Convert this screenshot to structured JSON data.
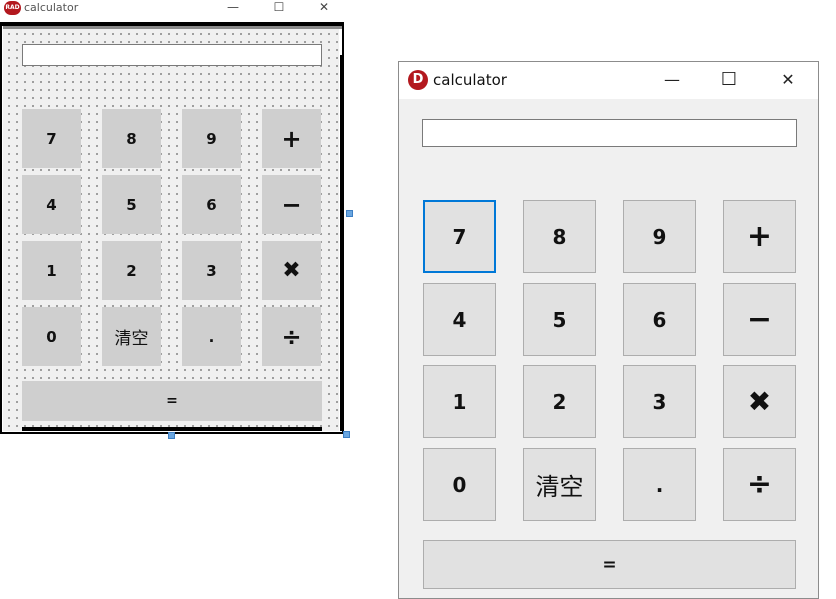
{
  "designer": {
    "logo_text": "RAD",
    "title": "calculator",
    "controls": {
      "minimize": "—",
      "maximize": "☐",
      "close": "✕"
    },
    "display_value": "",
    "buttons": {
      "b7": "7",
      "b8": "8",
      "b9": "9",
      "plus": "+",
      "b4": "4",
      "b5": "5",
      "b6": "6",
      "minus": "−",
      "b1": "1",
      "b2": "2",
      "b3": "3",
      "multiply": "✖",
      "b0": "0",
      "clear": "清空",
      "dot": ".",
      "divide": "÷",
      "equals": "="
    }
  },
  "window": {
    "logo_text": "D",
    "title": "calculator",
    "controls": {
      "minimize": "—",
      "maximize": "☐",
      "close": "✕"
    },
    "display_value": "",
    "buttons": {
      "b7": "7",
      "b8": "8",
      "b9": "9",
      "plus": "+",
      "b4": "4",
      "b5": "5",
      "b6": "6",
      "minus": "−",
      "b1": "1",
      "b2": "2",
      "b3": "3",
      "multiply": "✖",
      "b0": "0",
      "clear": "清空",
      "dot": ".",
      "divide": "÷",
      "equals": "="
    }
  },
  "colors": {
    "brand_red": "#b3181e",
    "focus_blue": "#0078d7",
    "button_gray": "#e1e1e1"
  }
}
